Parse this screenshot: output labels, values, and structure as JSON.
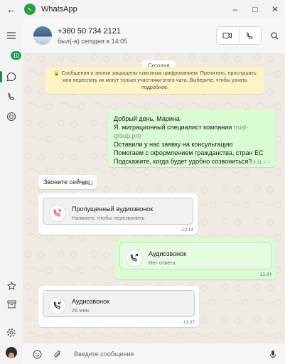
{
  "window": {
    "title": "WhatsApp"
  },
  "rail": {
    "chats_badge": "10"
  },
  "contact": {
    "phone": "+380 50 734 2121",
    "status": "был(-а) сегодня в 14:05"
  },
  "date_label": "Сегодня",
  "encryption_note": "🔒 Сообщения и звонки защищены сквозным шифрованием. Прочитать, прослушать или переслать их могут только участники этого чата. Выберите, чтобы узнать подробнее.",
  "messages": {
    "m1": {
      "line1": "Добрый день, Марина",
      "line2_a": "Я. миграционный специалист компании ",
      "line2_b": "trust-",
      "line3": "group.pro",
      "line4": "Оставили у нас заявку на консультацию",
      "line5": "Помогаем с оформлением гражданства, стран ЕС",
      "line6": "Подскажите, когда будет удобно созвониться?",
      "time": "13:11",
      "ticks": "✓✓"
    },
    "m2": {
      "text": "Звоните сейчас",
      "time": "13:13"
    },
    "m3": {
      "title": "Пропущенный аудиозвонок",
      "subtitle": "Нажмите, чтобы перезвонить",
      "time": "13:14"
    },
    "m4": {
      "title": "Аудиозвонок",
      "subtitle": "Нет ответа",
      "time": "13:34"
    },
    "m5": {
      "title": "Аудиозвонок",
      "subtitle": "26 мин.",
      "time": "13:37"
    }
  },
  "composer": {
    "placeholder": "Введите сообщение"
  },
  "colors": {
    "accent": "#25a244",
    "outgoing": "#d9fdd3",
    "incoming": "#ffffff",
    "missed": "#e53935"
  }
}
